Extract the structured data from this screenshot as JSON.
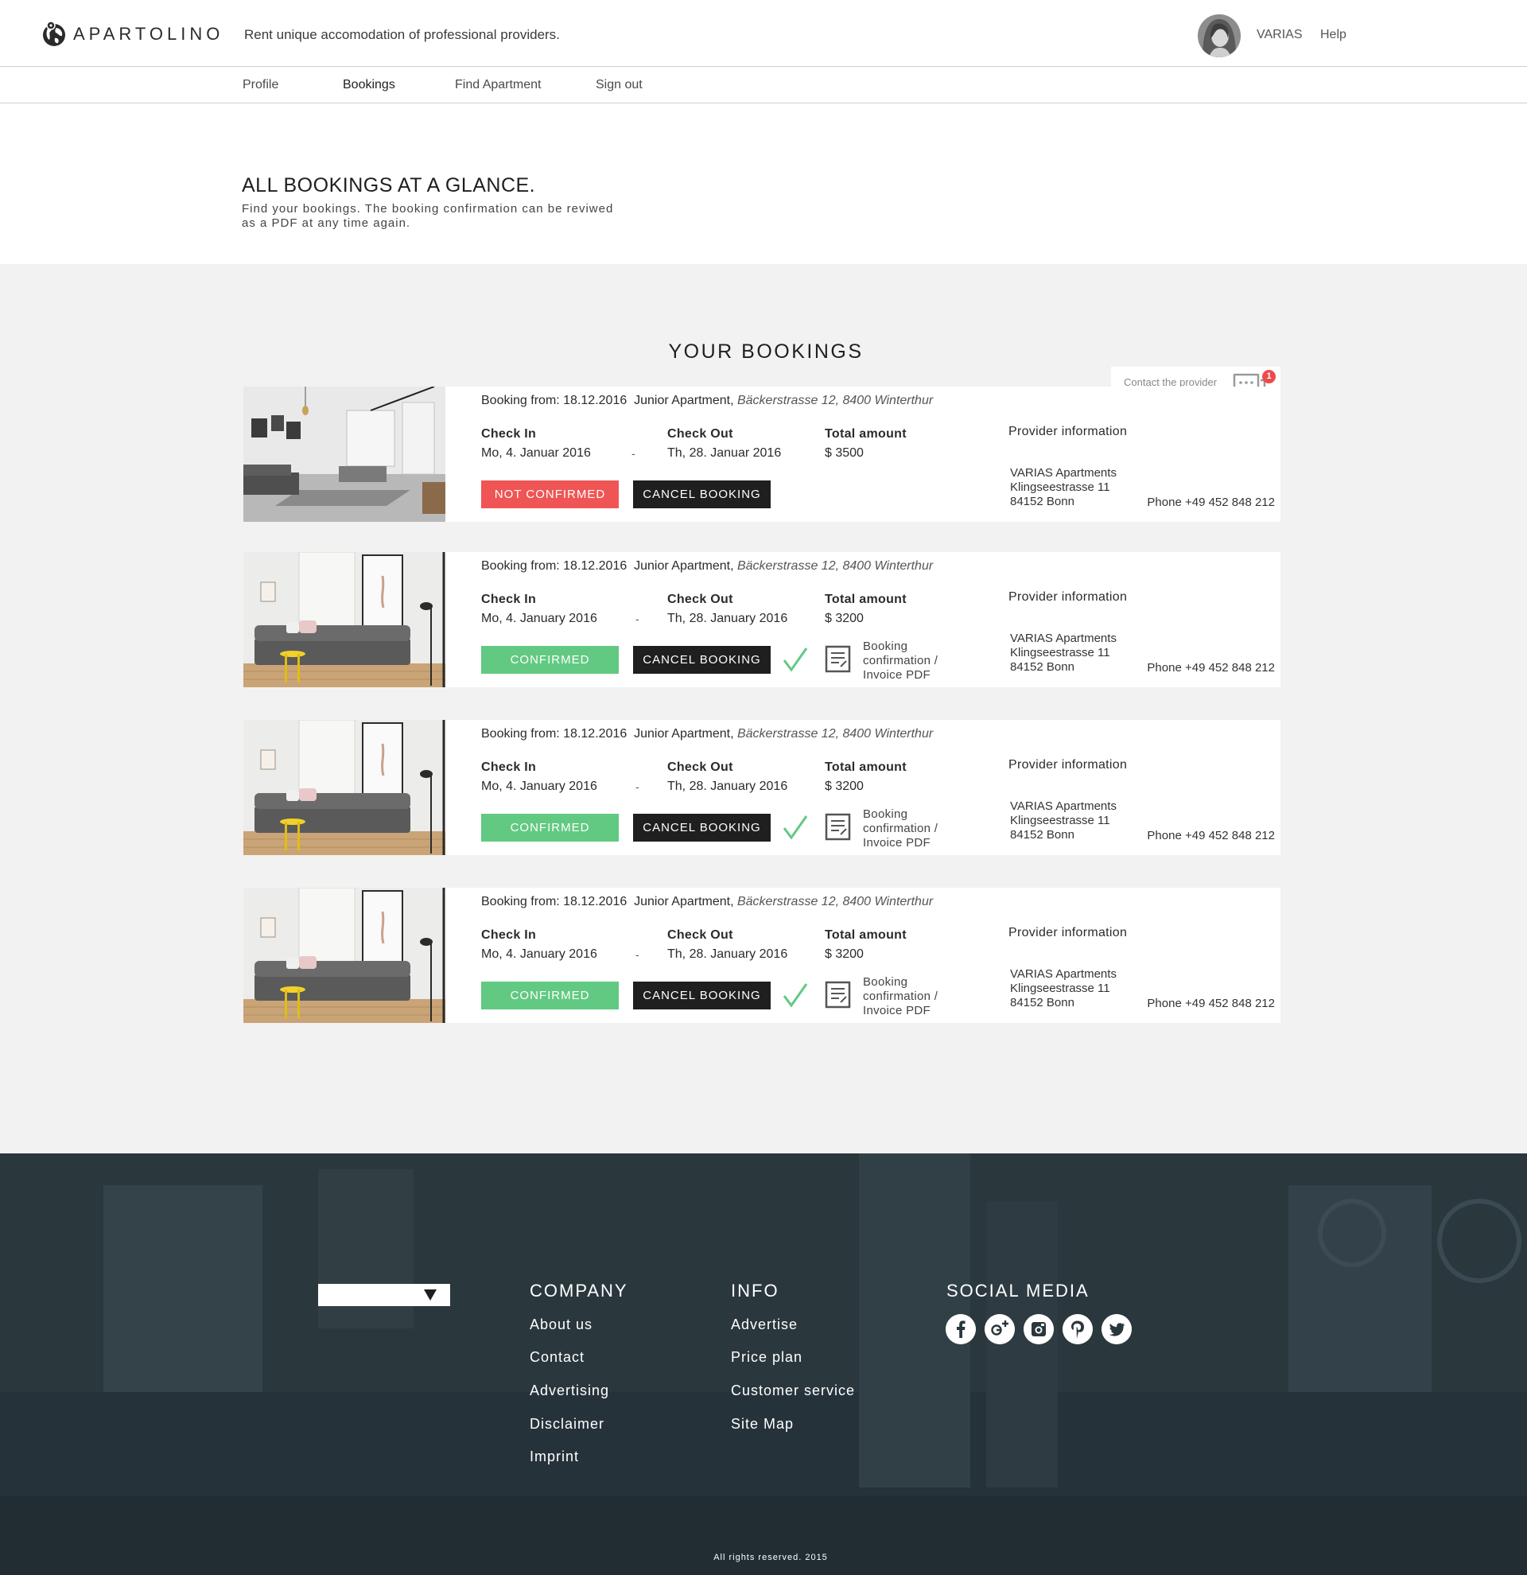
{
  "header": {
    "brand": "APARTOLINO",
    "tagline": "Rent unique accomodation of professional providers.",
    "user_name": "VARIAS",
    "help_label": "Help"
  },
  "nav": {
    "items": [
      {
        "label": "Profile"
      },
      {
        "label": "Bookings"
      },
      {
        "label": "Find Apartment"
      },
      {
        "label": "Sign out"
      }
    ],
    "active": "Bookings"
  },
  "intro": {
    "title": "ALL BOOKINGS AT A GLANCE.",
    "description": "Find your bookings. The booking confirmation can be reviwed as a PDF at any time again."
  },
  "bookings": {
    "section_title": "YOUR BOOKINGS",
    "contact_label": "Contact the provider",
    "unread_count": "1",
    "labels": {
      "check_in": "Check In",
      "check_out": "Check Out",
      "total": "Total amount",
      "provider": "Provider information",
      "cancel": "CANCEL BOOKING",
      "dash": "-",
      "pdf": "Booking confirmation / Invoice PDF"
    },
    "items": [
      {
        "booking_from": "Booking from: 18.12.2016",
        "apartment": "Junior Apartment,",
        "address": "Bäckerstrasse 12, 8400 Winterthur",
        "check_in": "Mo, 4. Januar 2016",
        "check_out": "Th, 28. Januar 2016",
        "total": "$ 3500",
        "status": "NOT CONFIRMED",
        "provider_name": "VARIAS Apartments",
        "provider_street": "Klingseestrasse 11",
        "provider_city": "84152 Bonn",
        "provider_phone": "Phone +49 452 848 212"
      },
      {
        "booking_from": "Booking from: 18.12.2016",
        "apartment": "Junior Apartment,",
        "address": "Bäckerstrasse 12, 8400 Winterthur",
        "check_in": "Mo, 4. January 2016",
        "check_out": "Th, 28. January 2016",
        "total": "$ 3200",
        "status": "CONFIRMED",
        "provider_name": "VARIAS Apartments",
        "provider_street": "Klingseestrasse 11",
        "provider_city": "84152 Bonn",
        "provider_phone": "Phone +49 452 848 212"
      },
      {
        "booking_from": "Booking from: 18.12.2016",
        "apartment": "Junior Apartment,",
        "address": "Bäckerstrasse 12, 8400 Winterthur",
        "check_in": "Mo, 4. January 2016",
        "check_out": "Th, 28. January 2016",
        "total": "$ 3200",
        "status": "CONFIRMED",
        "provider_name": "VARIAS Apartments",
        "provider_street": "Klingseestrasse 11",
        "provider_city": "84152 Bonn",
        "provider_phone": "Phone +49 452 848 212"
      },
      {
        "booking_from": "Booking from: 18.12.2016",
        "apartment": "Junior Apartment,",
        "address": "Bäckerstrasse 12, 8400 Winterthur",
        "check_in": "Mo, 4. January 2016",
        "check_out": "Th, 28. January 2016",
        "total": "$ 3200",
        "status": "CONFIRMED",
        "provider_name": "VARIAS Apartments",
        "provider_street": "Klingseestrasse 11",
        "provider_city": "84152 Bonn",
        "provider_phone": "Phone +49 452 848 212"
      }
    ]
  },
  "footer": {
    "company_heading": "COMPANY",
    "company_links": [
      "About us",
      "Contact",
      "Advertising",
      "Disclaimer",
      "Imprint"
    ],
    "info_heading": "INFO",
    "info_links": [
      "Advertise",
      "Price plan",
      "Customer service",
      "Site Map"
    ],
    "social_heading": "SOCIAL MEDIA",
    "social_icons": [
      "facebook-icon",
      "google-plus-icon",
      "instagram-icon",
      "pinterest-icon",
      "twitter-icon"
    ],
    "copyright": "All rights reserved. 2015"
  },
  "colors": {
    "not_confirmed": "#ef5555",
    "confirmed": "#62c982",
    "cancel": "#1f1f1f",
    "footer_bg": "#2a373d",
    "badge": "#ef4b4b"
  }
}
